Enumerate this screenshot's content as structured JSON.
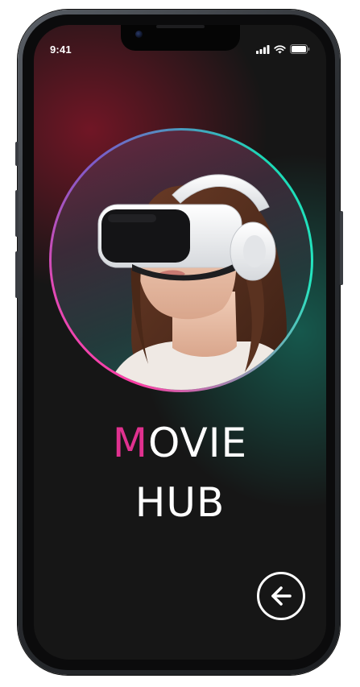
{
  "status_bar": {
    "time": "9:41",
    "icons": [
      "signal-icon",
      "wifi-icon",
      "battery-icon"
    ]
  },
  "hero": {
    "image": "woman-vr-headset",
    "ring_colors": [
      "#ff3ea5",
      "#25e6c0"
    ]
  },
  "title": {
    "accent_letter": "M",
    "line1_rest": "OVIE",
    "line2": "HUB",
    "accent_color": "#e0318f"
  },
  "actions": {
    "back_icon": "arrow-left-circle-icon"
  },
  "colors": {
    "background": "#161616",
    "glow_top_left": "#801628",
    "glow_right": "#166e5f",
    "text": "#ffffff"
  }
}
